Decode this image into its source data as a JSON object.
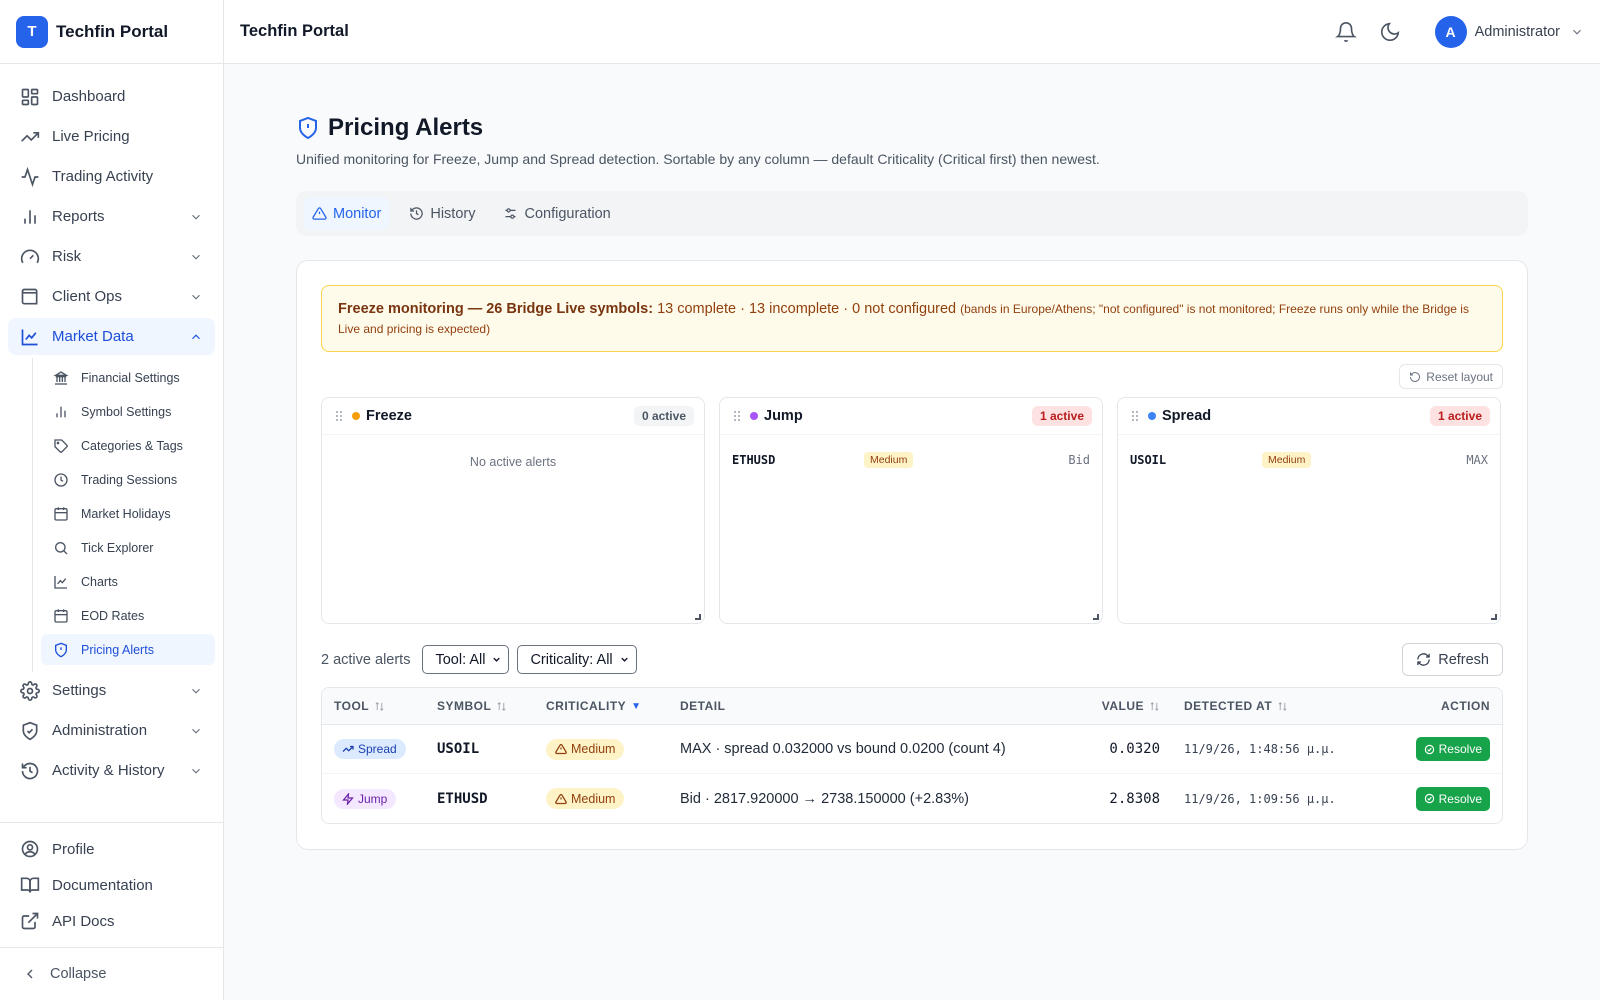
{
  "brand": {
    "logo_letter": "T",
    "name": "Techfin Portal"
  },
  "topbar": {
    "title": "Techfin Portal",
    "user_initial": "A",
    "user_name": "Administrator"
  },
  "sidebar": {
    "items": [
      {
        "label": "Dashboard",
        "icon": "dashboard-icon"
      },
      {
        "label": "Live Pricing",
        "icon": "trending-up-icon"
      },
      {
        "label": "Trading Activity",
        "icon": "activity-icon"
      },
      {
        "label": "Reports",
        "icon": "bar-chart-icon"
      },
      {
        "label": "Risk",
        "icon": "gauge-icon"
      },
      {
        "label": "Client Ops",
        "icon": "wallet-icon"
      },
      {
        "label": "Market Data",
        "icon": "line-chart-icon"
      }
    ],
    "sub_items": [
      {
        "label": "Financial Settings",
        "icon": "bank-icon"
      },
      {
        "label": "Symbol Settings",
        "icon": "bars-icon"
      },
      {
        "label": "Categories & Tags",
        "icon": "tag-icon"
      },
      {
        "label": "Trading Sessions",
        "icon": "clock-icon"
      },
      {
        "label": "Market Holidays",
        "icon": "calendar-icon"
      },
      {
        "label": "Tick Explorer",
        "icon": "search-icon"
      },
      {
        "label": "Charts",
        "icon": "line-chart-icon"
      },
      {
        "label": "EOD Rates",
        "icon": "calendar-icon"
      },
      {
        "label": "Pricing Alerts",
        "icon": "shield-alert-icon"
      }
    ],
    "items_after": [
      {
        "label": "Settings",
        "icon": "gear-icon"
      },
      {
        "label": "Administration",
        "icon": "shield-check-icon"
      },
      {
        "label": "Activity & History",
        "icon": "history-icon"
      }
    ],
    "bottom": [
      {
        "label": "Profile",
        "icon": "user-circle-icon"
      },
      {
        "label": "Documentation",
        "icon": "book-icon"
      },
      {
        "label": "API Docs",
        "icon": "external-link-icon"
      }
    ],
    "collapse_label": "Collapse"
  },
  "page": {
    "title": "Pricing Alerts",
    "subtitle": "Unified monitoring for Freeze, Jump and Spread detection. Sortable by any column — default Criticality (Critical first) then newest.",
    "tabs": [
      {
        "label": "Monitor"
      },
      {
        "label": "History"
      },
      {
        "label": "Configuration"
      }
    ]
  },
  "banner": {
    "bold": "Freeze monitoring — 26 Bridge Live symbols:",
    "main": " 13 complete · 13 incomplete · 0 not configured ",
    "small": "(bands in Europe/Athens; \"not configured\" is not monitored; Freeze runs only while the Bridge is Live and pricing is expected)"
  },
  "reset_label": "Reset layout",
  "panels": {
    "freeze": {
      "title": "Freeze",
      "count": "0 active",
      "empty": "No active alerts",
      "color": "#f59e0b"
    },
    "jump": {
      "title": "Jump",
      "count": "1 active",
      "color": "#a855f7",
      "row": {
        "symbol": "ETHUSD",
        "criticality": "Medium",
        "kind": "Bid"
      }
    },
    "spread": {
      "title": "Spread",
      "count": "1 active",
      "color": "#3b82f6",
      "row": {
        "symbol": "USOIL",
        "criticality": "Medium",
        "kind": "MAX"
      }
    }
  },
  "filters": {
    "active_count": "2 active alerts",
    "tool": "Tool: All",
    "criticality": "Criticality: All",
    "refresh": "Refresh"
  },
  "table": {
    "headers": {
      "tool": "TOOL",
      "symbol": "SYMBOL",
      "criticality": "CRITICALITY",
      "detail": "DETAIL",
      "value": "VALUE",
      "detected": "DETECTED AT",
      "action": "ACTION"
    },
    "rows": [
      {
        "tool": "Spread",
        "symbol": "USOIL",
        "criticality": "Medium",
        "detail": "MAX · spread 0.032000 vs bound 0.0200 (count 4)",
        "value": "0.0320",
        "detected": "11/9/26, 1:48:56 μ.μ.",
        "action": "Resolve"
      },
      {
        "tool": "Jump",
        "symbol": "ETHUSD",
        "criticality": "Medium",
        "detail": "Bid · 2817.920000 → 2738.150000 (+2.83%)",
        "value": "2.8308",
        "detected": "11/9/26, 1:09:56 μ.μ.",
        "action": "Resolve"
      }
    ]
  }
}
